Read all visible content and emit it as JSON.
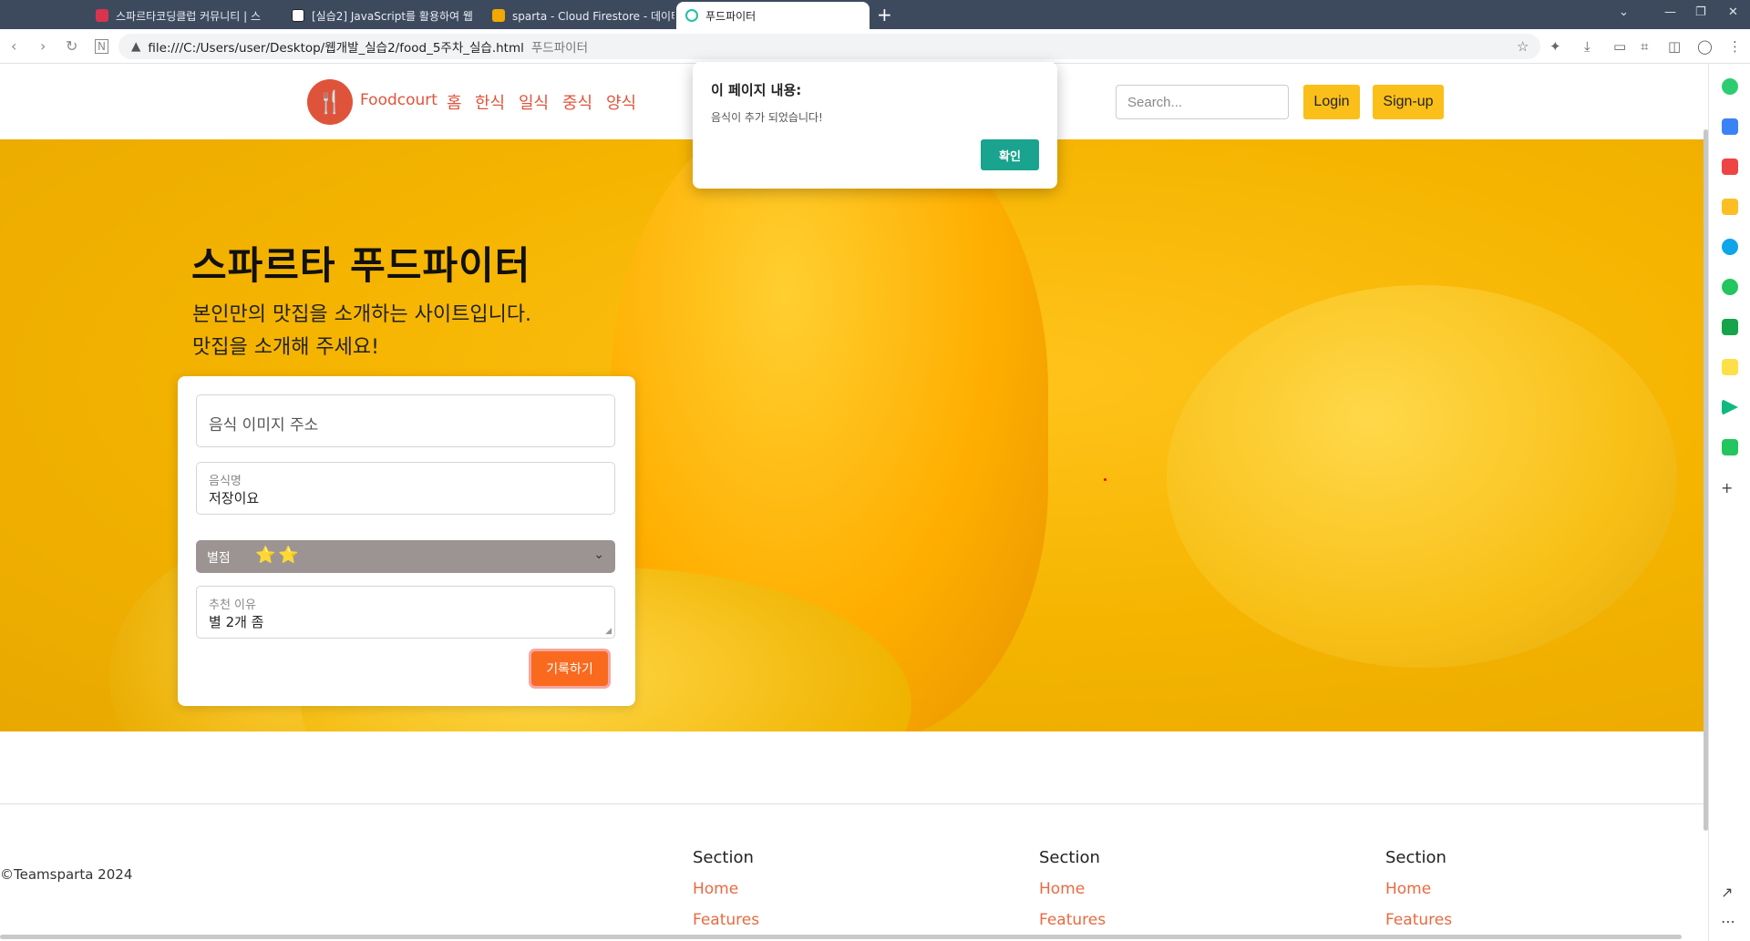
{
  "browser": {
    "tabs": [
      {
        "title": "스파르타코딩클럽 커뮤니티 | 스",
        "color": "#d8344f"
      },
      {
        "title": "[실습2] JavaScript를 활용하여 웹",
        "color": "#222222"
      },
      {
        "title": "sparta - Cloud Firestore - 데이터",
        "color": "#f2a900"
      },
      {
        "title": "푸드파이터",
        "color": "#20c0a0"
      }
    ],
    "url": "file:///C:/Users/user/Desktop/웹개발_실습2/food_5주차_실습.html",
    "site_label": "푸드파이터"
  },
  "header": {
    "brand": "Foodcourt",
    "nav": [
      "홈",
      "한식",
      "일식",
      "중식",
      "양식"
    ],
    "search_placeholder": "Search...",
    "login_label": "Login",
    "signup_label": "Sign-up"
  },
  "hero": {
    "title": "스파르타 푸드파이터",
    "subtitle_line1": "본인만의 맛집을 소개하는 사이트입니다.",
    "subtitle_line2": "맛집을 소개해 주세요!"
  },
  "form": {
    "image_placeholder": "음식 이미지 주소",
    "name_label": "음식명",
    "name_value": "저장이요",
    "rating_label": "별점",
    "rating_stars": "⭐⭐",
    "reason_label": "추천 이유",
    "reason_value": "별 2개 좀",
    "submit_label": "기록하기"
  },
  "dialog": {
    "title": "이 페이지 내용:",
    "message": "음식이 추가 되었습니다!",
    "ok_label": "확인"
  },
  "footer": {
    "copyright": "©Teamsparta 2024",
    "sections": [
      {
        "title": "Section",
        "links": [
          "Home",
          "Features"
        ]
      },
      {
        "title": "Section",
        "links": [
          "Home",
          "Features"
        ]
      },
      {
        "title": "Section",
        "links": [
          "Home",
          "Features"
        ]
      }
    ]
  },
  "colors": {
    "accent": "#e0533b",
    "button_yellow": "#fbbf1a",
    "submit_orange": "#fa6a1e",
    "dialog_teal": "#1aa38e"
  },
  "side_panel_icons": [
    "whatsapp-icon",
    "calendar-icon",
    "pocket-icon",
    "star-icon",
    "edge-icon",
    "play-icon",
    "webtoon-icon",
    "note-icon",
    "play-store-icon",
    "blog-icon",
    "plus-icon",
    "external-link-icon",
    "more-icon"
  ]
}
